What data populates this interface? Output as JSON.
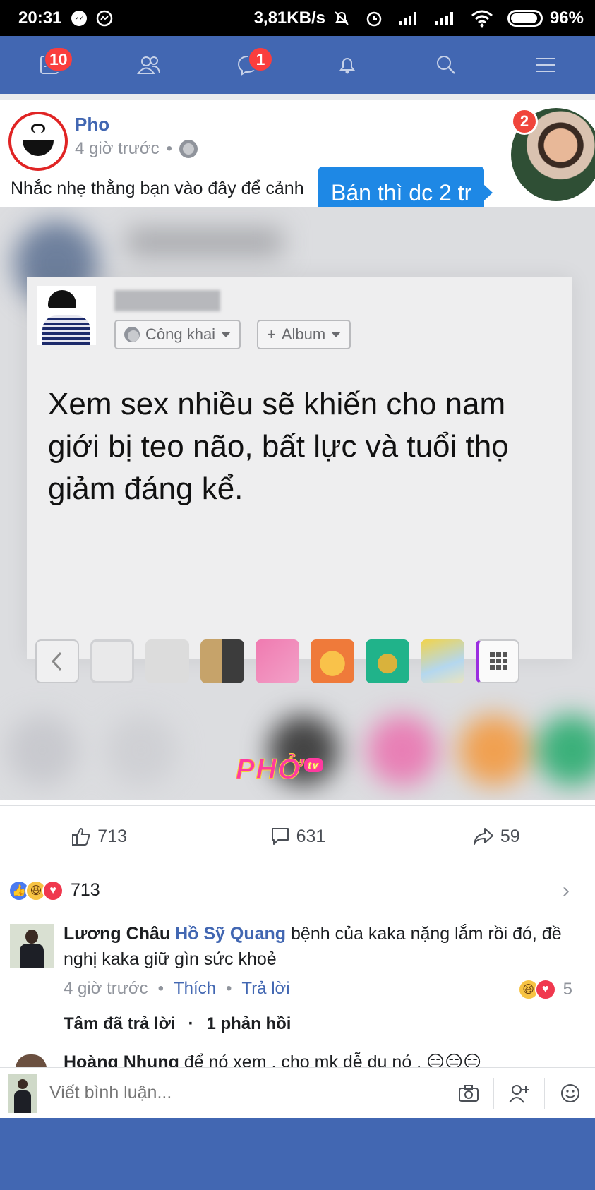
{
  "status_bar": {
    "time": "20:31",
    "net_speed": "3,81KB/s",
    "battery": "96%"
  },
  "nav": {
    "items": [
      {
        "name": "news-feed",
        "badge": "10"
      },
      {
        "name": "friends",
        "badge": ""
      },
      {
        "name": "messages",
        "badge": "1"
      },
      {
        "name": "notifications",
        "badge": ""
      },
      {
        "name": "search",
        "badge": ""
      },
      {
        "name": "menu",
        "badge": ""
      }
    ]
  },
  "post": {
    "author": "Pho",
    "time": "4 giờ trước",
    "separator": "•",
    "caption": "Nhắc nhẹ thằng bạn vào đây để cảnh",
    "chat_head": {
      "badge": "2",
      "bubble_text": "Bán thì dc 2 tr"
    },
    "image": {
      "privacy_label": "Công khai",
      "album_label": "Album",
      "album_plus": "+",
      "text": "Xem sex nhiều sẽ khiến cho nam giới bị teo não, bất lực và tuổi thọ giảm đáng kể.",
      "watermark": "PHỞ",
      "watermark_tv": "tv"
    },
    "actions": {
      "likes": "713",
      "comments": "631",
      "shares": "59"
    },
    "reactions_count": "713"
  },
  "comment": {
    "author": "Lương Châu",
    "tag": "Hồ Sỹ Quang",
    "text": " bệnh của kaka nặng lắm rồi đó, đề nghị kaka giữ gìn sức khoẻ",
    "time": "4 giờ trước",
    "like_label": "Thích",
    "reply_label": "Trả lời",
    "reaction_count": "5",
    "replier": "Tâm đã trả lời",
    "reply_count": "1 phản hồi"
  },
  "next_comment": {
    "author": "Hoàng Nhung",
    "text": " để nó xem , cho mk dễ dụ nó , 😑😑😑"
  },
  "write_bar": {
    "placeholder": "Viết bình luận..."
  },
  "colors": {
    "brand": "#4267b2",
    "badge": "#fa3e3e",
    "bubble": "#1e88e5"
  }
}
